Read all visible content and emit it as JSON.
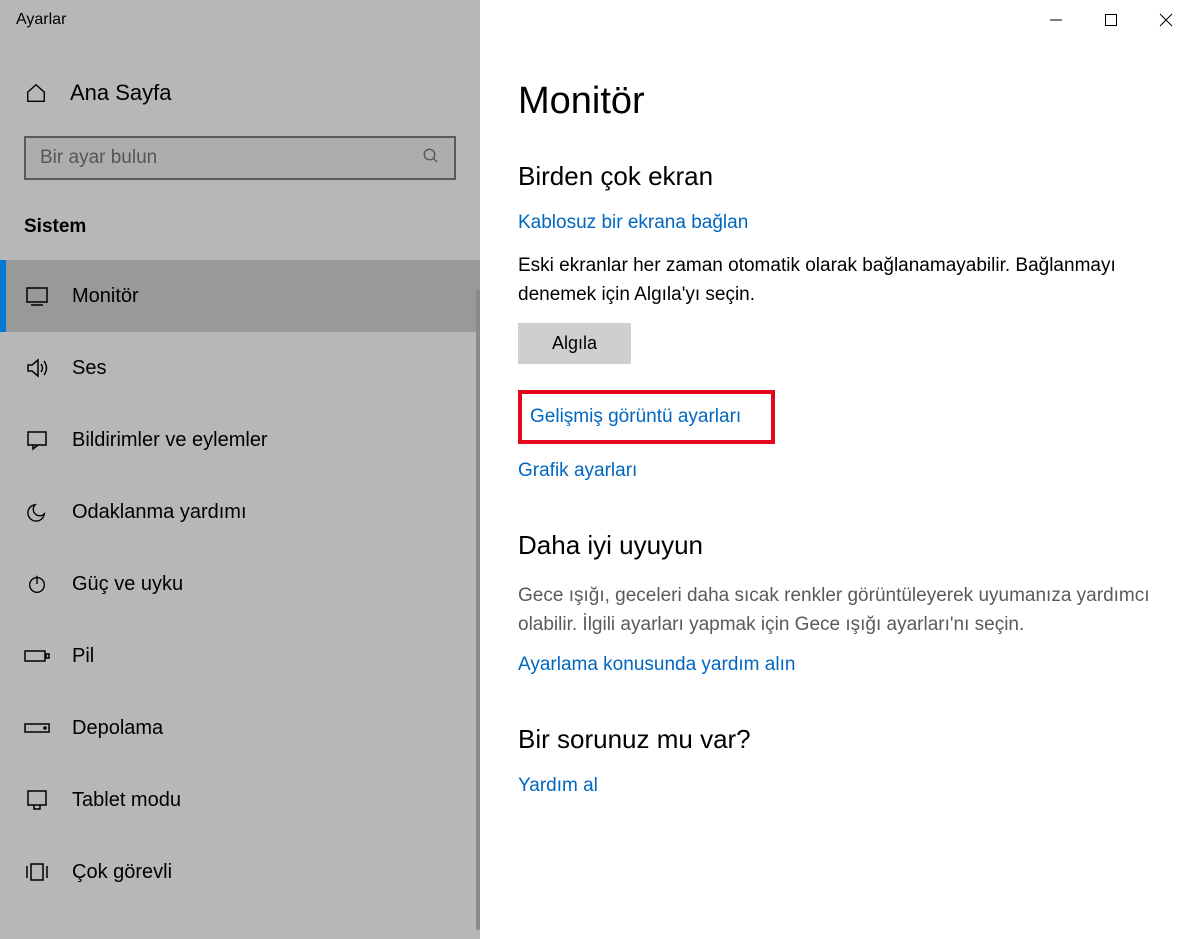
{
  "window": {
    "title": "Ayarlar"
  },
  "sidebar": {
    "home_label": "Ana Sayfa",
    "search_placeholder": "Bir ayar bulun",
    "section_label": "Sistem",
    "items": [
      {
        "label": "Monitör"
      },
      {
        "label": "Ses"
      },
      {
        "label": "Bildirimler ve eylemler"
      },
      {
        "label": "Odaklanma yardımı"
      },
      {
        "label": "Güç ve uyku"
      },
      {
        "label": "Pil"
      },
      {
        "label": "Depolama"
      },
      {
        "label": "Tablet modu"
      },
      {
        "label": "Çok görevli"
      }
    ]
  },
  "main": {
    "page_title": "Monitör",
    "multi_display": {
      "heading": "Birden çok ekran",
      "wireless_link": "Kablosuz bir ekrana bağlan",
      "legacy_text": "Eski ekranlar her zaman otomatik olarak bağlanamayabilir. Bağlanmayı denemek için Algıla'yı seçin.",
      "detect_button": "Algıla",
      "advanced_link": "Gelişmiş görüntü ayarları",
      "graphics_link": "Grafik ayarları"
    },
    "sleep_better": {
      "heading": "Daha iyi uyuyun",
      "body": "Gece ışığı, geceleri daha sıcak renkler görüntüleyerek uyumanıza yardımcı olabilir. İlgili ayarları yapmak için Gece ışığı ayarları'nı seçin.",
      "help_link": "Ayarlama konusunda yardım alın"
    },
    "question": {
      "heading": "Bir sorunuz mu var?",
      "help_link": "Yardım al"
    }
  }
}
